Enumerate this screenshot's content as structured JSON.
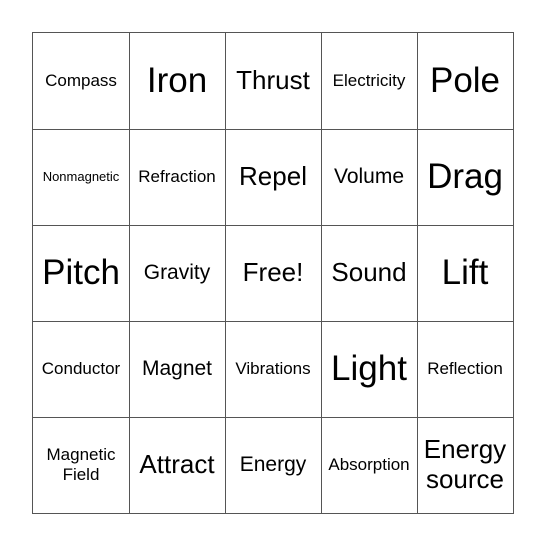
{
  "board": {
    "cells": [
      {
        "text": "Compass",
        "size": "s2"
      },
      {
        "text": "Iron",
        "size": "s5"
      },
      {
        "text": "Thrust",
        "size": "s4"
      },
      {
        "text": "Electricity",
        "size": "s2"
      },
      {
        "text": "Pole",
        "size": "s5"
      },
      {
        "text": "Nonmagnetic",
        "size": "s1"
      },
      {
        "text": "Refraction",
        "size": "s2"
      },
      {
        "text": "Repel",
        "size": "s4"
      },
      {
        "text": "Volume",
        "size": "s3"
      },
      {
        "text": "Drag",
        "size": "s5"
      },
      {
        "text": "Pitch",
        "size": "s5"
      },
      {
        "text": "Gravity",
        "size": "s3"
      },
      {
        "text": "Free!",
        "size": "s4"
      },
      {
        "text": "Sound",
        "size": "s4"
      },
      {
        "text": "Lift",
        "size": "s5"
      },
      {
        "text": "Conductor",
        "size": "s2"
      },
      {
        "text": "Magnet",
        "size": "s3"
      },
      {
        "text": "Vibrations",
        "size": "s2"
      },
      {
        "text": "Light",
        "size": "s5"
      },
      {
        "text": "Reflection",
        "size": "s2"
      },
      {
        "text": "Magnetic Field",
        "size": "s2"
      },
      {
        "text": "Attract",
        "size": "s4"
      },
      {
        "text": "Energy",
        "size": "s3"
      },
      {
        "text": "Absorption",
        "size": "s2"
      },
      {
        "text": "Energy source",
        "size": "s4"
      }
    ]
  }
}
